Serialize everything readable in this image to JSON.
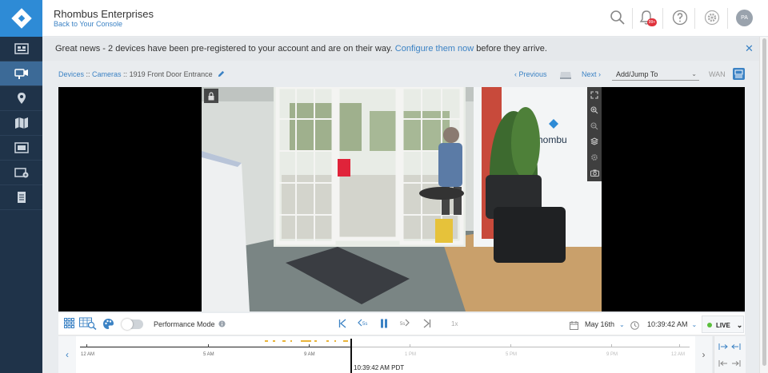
{
  "header": {
    "company": "Rhombus Enterprises",
    "back_link": "Back to Your Console",
    "notification_badge": "99+",
    "avatar_initials": "PA"
  },
  "sidebar": {
    "items": [
      {
        "icon": "console-icon"
      },
      {
        "icon": "cameras-icon"
      },
      {
        "icon": "locations-icon"
      },
      {
        "icon": "map-icon"
      },
      {
        "icon": "video-wall-icon"
      },
      {
        "icon": "alerts-icon"
      },
      {
        "icon": "reports-icon"
      }
    ],
    "active_index": 1
  },
  "banner": {
    "text_before": "Great news - 2 devices have been pre-registered to your account and are on their way. ",
    "link": "Configure them now",
    "text_after": " before they arrive."
  },
  "breadcrumb": {
    "devices": "Devices",
    "sep1": " :: ",
    "cameras": "Cameras",
    "sep2": " :: ",
    "camera_name": "1919 Front Door Entrance"
  },
  "nav": {
    "previous": "Previous",
    "next": "Next",
    "jump_placeholder": "Add/Jump To",
    "wan_label": "WAN"
  },
  "controls": {
    "performance_mode": "Performance Mode",
    "rewind_label": "5s",
    "forward_label": "5s",
    "speed": "1x",
    "date": "May 16th",
    "time": "10:39:42 AM",
    "live": "LIVE"
  },
  "timeline": {
    "labels": [
      "12 AM",
      "5 AM",
      "9 AM",
      "1 PM",
      "5 PM",
      "9 PM",
      "12 AM"
    ],
    "current_time": "10:39:42 AM PDT"
  },
  "colors": {
    "brand": "#2e8bd6",
    "sidebar": "#1f3349",
    "link": "#3b82c4",
    "live": "#5bbf3c",
    "motion": "#e9b43a"
  }
}
